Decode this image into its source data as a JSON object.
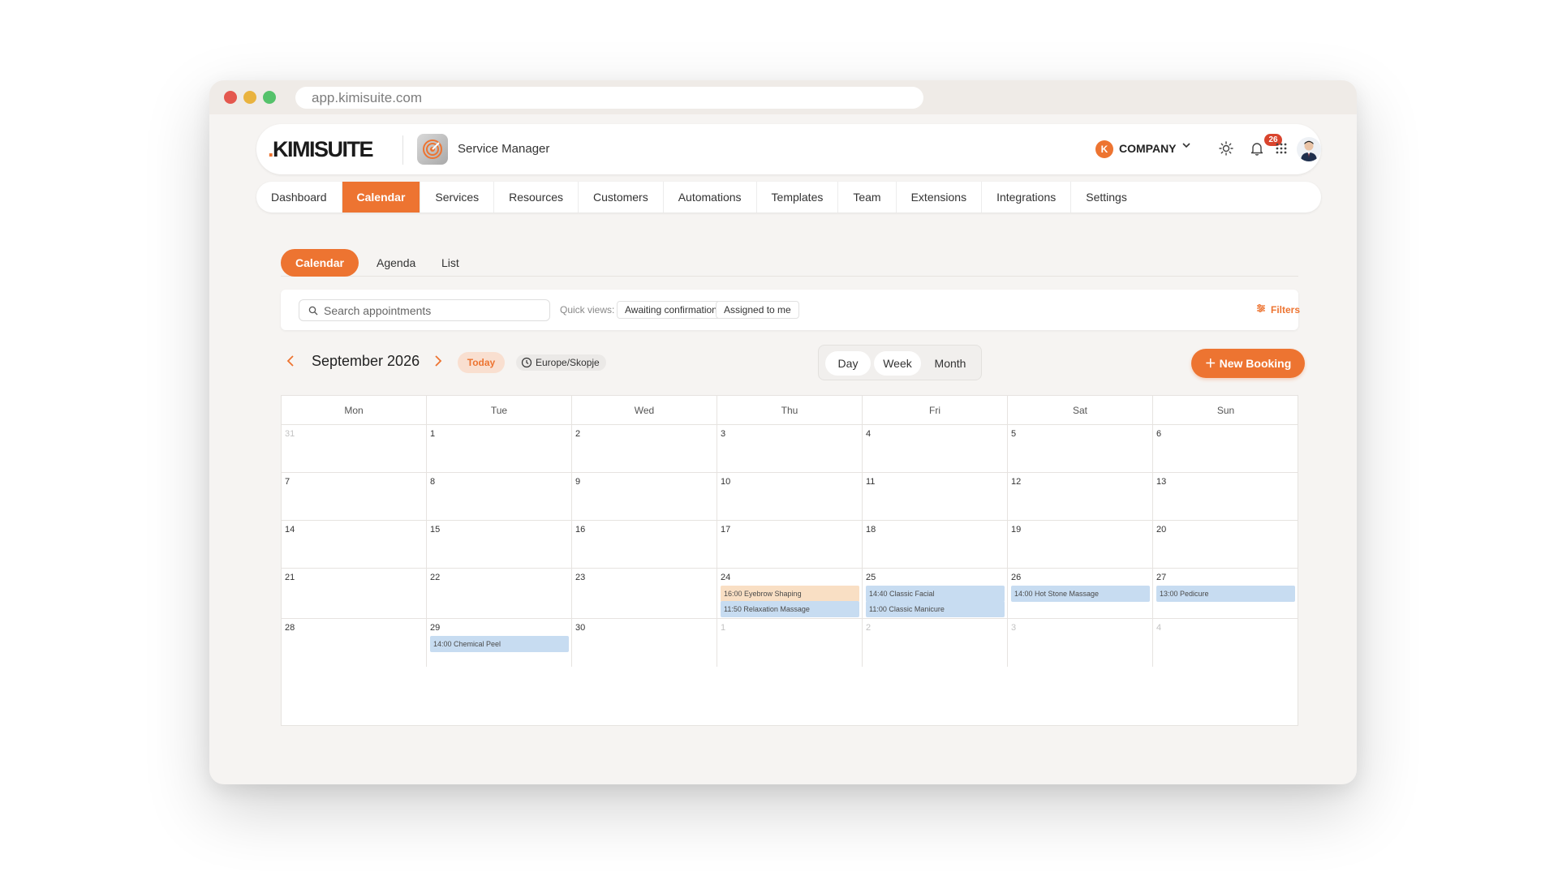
{
  "browser": {
    "url": "app.kimisuite.com"
  },
  "header": {
    "logo_dot": ".",
    "logo_text": "KIMISUITE",
    "app_name": "Service Manager",
    "company_badge": "K",
    "company_name": "COMPANY",
    "notification_count": "26"
  },
  "nav": {
    "items": [
      "Dashboard",
      "Calendar",
      "Services",
      "Resources",
      "Customers",
      "Automations",
      "Templates",
      "Team",
      "Extensions",
      "Integrations",
      "Settings"
    ],
    "active": "Calendar"
  },
  "subtabs": {
    "items": [
      "Calendar",
      "Agenda",
      "List"
    ],
    "active": "Calendar"
  },
  "toolbar": {
    "search_placeholder": "Search appointments",
    "quick_views_label": "Quick views:",
    "quick_views": [
      "Awaiting confirmation",
      "Assigned to me"
    ],
    "filters_label": "Filters"
  },
  "calendar_nav": {
    "month_title": "September 2026",
    "today_label": "Today",
    "timezone": "Europe/Skopje",
    "views": [
      "Day",
      "Week",
      "Month"
    ],
    "active_view": "Month",
    "new_booking_label": "New Booking"
  },
  "calendar": {
    "weekdays": [
      "Mon",
      "Tue",
      "Wed",
      "Thu",
      "Fri",
      "Sat",
      "Sun"
    ],
    "weeks": [
      [
        {
          "day": "31",
          "muted": true,
          "events": []
        },
        {
          "day": "1",
          "muted": false,
          "events": []
        },
        {
          "day": "2",
          "muted": false,
          "events": []
        },
        {
          "day": "3",
          "muted": false,
          "events": []
        },
        {
          "day": "4",
          "muted": false,
          "events": []
        },
        {
          "day": "5",
          "muted": false,
          "events": []
        },
        {
          "day": "6",
          "muted": false,
          "events": []
        }
      ],
      [
        {
          "day": "7",
          "muted": false,
          "events": []
        },
        {
          "day": "8",
          "muted": false,
          "events": []
        },
        {
          "day": "9",
          "muted": false,
          "events": []
        },
        {
          "day": "10",
          "muted": false,
          "events": []
        },
        {
          "day": "11",
          "muted": false,
          "events": []
        },
        {
          "day": "12",
          "muted": false,
          "events": []
        },
        {
          "day": "13",
          "muted": false,
          "events": []
        }
      ],
      [
        {
          "day": "14",
          "muted": false,
          "events": []
        },
        {
          "day": "15",
          "muted": false,
          "events": []
        },
        {
          "day": "16",
          "muted": false,
          "events": []
        },
        {
          "day": "17",
          "muted": false,
          "events": []
        },
        {
          "day": "18",
          "muted": false,
          "events": []
        },
        {
          "day": "19",
          "muted": false,
          "events": []
        },
        {
          "day": "20",
          "muted": false,
          "events": []
        }
      ],
      [
        {
          "day": "21",
          "muted": false,
          "events": []
        },
        {
          "day": "22",
          "muted": false,
          "events": []
        },
        {
          "day": "23",
          "muted": false,
          "events": []
        },
        {
          "day": "24",
          "muted": false,
          "events": [
            {
              "label": "16:00 Eyebrow Shaping",
              "color": "orange"
            },
            {
              "label": "11:50 Relaxation Massage",
              "color": "blue"
            }
          ]
        },
        {
          "day": "25",
          "muted": false,
          "events": [
            {
              "label": "14:40 Classic Facial",
              "color": "blue"
            },
            {
              "label": "11:00 Classic Manicure",
              "color": "blue"
            }
          ]
        },
        {
          "day": "26",
          "muted": false,
          "events": [
            {
              "label": "14:00 Hot Stone Massage",
              "color": "blue"
            }
          ]
        },
        {
          "day": "27",
          "muted": false,
          "events": [
            {
              "label": "13:00 Pedicure",
              "color": "blue"
            }
          ]
        }
      ],
      [
        {
          "day": "28",
          "muted": false,
          "events": []
        },
        {
          "day": "29",
          "muted": false,
          "events": [
            {
              "label": "14:00 Chemical Peel",
              "color": "blue"
            }
          ]
        },
        {
          "day": "30",
          "muted": false,
          "events": []
        },
        {
          "day": "1",
          "muted": true,
          "events": []
        },
        {
          "day": "2",
          "muted": true,
          "events": []
        },
        {
          "day": "3",
          "muted": true,
          "events": []
        },
        {
          "day": "4",
          "muted": true,
          "events": []
        }
      ]
    ]
  },
  "colors": {
    "accent": "#ed7431",
    "event_blue": "#c7dcf1",
    "event_orange": "#f9dfc4",
    "badge_red": "#d9442d"
  },
  "icons": {
    "search": "search-icon",
    "clock": "clock-icon",
    "filter": "filter-icon",
    "sun": "sun-icon",
    "bell": "bell-icon",
    "grid": "apps-grid-icon"
  }
}
